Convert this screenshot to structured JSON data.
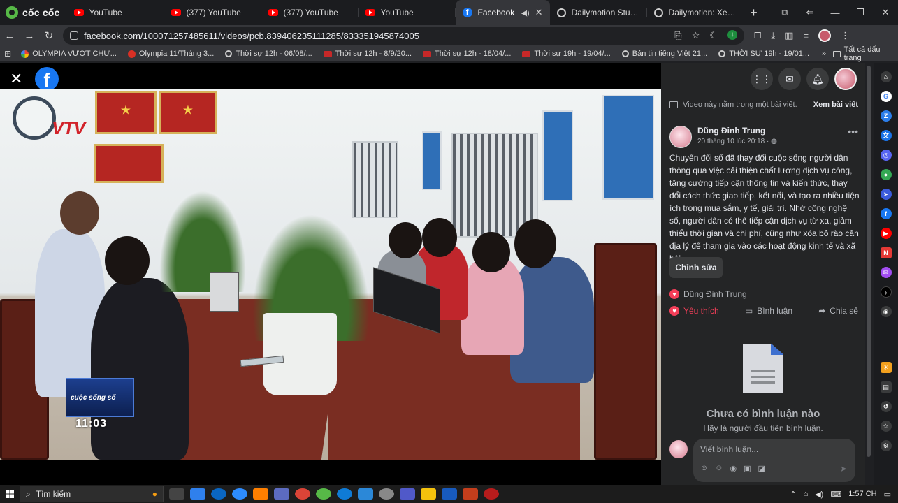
{
  "browser": {
    "brand": "cốc cốc",
    "tabs": [
      {
        "title": "YouTube",
        "icon": "youtube-icon",
        "active": false
      },
      {
        "title": "(377) YouTube",
        "icon": "youtube-icon",
        "active": false
      },
      {
        "title": "(377) YouTube",
        "icon": "youtube-icon",
        "active": false
      },
      {
        "title": "YouTube",
        "icon": "youtube-icon",
        "active": false
      },
      {
        "title": "Facebook",
        "icon": "facebook-icon",
        "active": true
      },
      {
        "title": "Dailymotion Studio",
        "icon": "dailymotion-icon",
        "active": false
      },
      {
        "title": "Dailymotion: Xem và c",
        "icon": "dailymotion-icon",
        "active": false
      }
    ],
    "url": "facebook.com/100071257485611/videos/pcb.839406235111285/833351945874005",
    "bookmarks": [
      {
        "label": "OLYMPIA VƯỢT CHƯ...",
        "icon": "google-icon"
      },
      {
        "label": "Olympia 11/Tháng 3...",
        "icon": "olympia-icon"
      },
      {
        "label": "Thời sự 12h - 06/08/...",
        "icon": "dailymotion-icon"
      },
      {
        "label": "Thời sự 12h - 8/9/20...",
        "icon": "vtv-icon"
      },
      {
        "label": "Thời sự 12h - 18/04/...",
        "icon": "vtv-icon"
      },
      {
        "label": "Thời sự 19h - 19/04/...",
        "icon": "vtv-icon"
      },
      {
        "label": "Bản tin tiếng Việt 21...",
        "icon": "dailymotion-icon"
      },
      {
        "label": "THỜI SỰ 19h - 19/01...",
        "icon": "dailymotion-icon"
      }
    ],
    "bookmarks_folder": "Tất cả dấu trang"
  },
  "video": {
    "channel_logo": "VTV",
    "ticker_label": "cuộc sống số",
    "ticker_time": "11:03"
  },
  "post": {
    "notice": "Video này nằm trong một bài viết.",
    "notice_link": "Xem bài viết",
    "author": "Dũng Đinh Trung",
    "time": "20 tháng 10 lúc 20:18 ·",
    "body": "Chuyển đổi số đã thay đổi cuộc sống người dân thông qua việc cải thiện chất lượng dịch vụ công, tăng cường tiếp cận thông tin và kiến thức, thay đổi cách thức giao tiếp, kết nối, và tạo ra nhiều tiện ích trong mua sắm, y tế, giải trí. Nhờ công nghệ số, người dân có thể tiếp cận dịch vụ từ xa, giảm thiểu thời gian và chi phí, cũng như xóa bỏ rào cản địa lý để tham gia vào các hoạt động kinh tế và xã hội",
    "edit_label": "Chỉnh sửa",
    "reactor": "Dũng Đinh Trung",
    "actions": {
      "like": "Yêu thích",
      "comment": "Bình luận",
      "share": "Chia sẻ"
    },
    "empty_title": "Chưa có bình luận nào",
    "empty_sub": "Hãy là người đầu tiên bình luận.",
    "comment_placeholder": "Viết bình luận..."
  },
  "taskbar": {
    "search_label": "Tìm kiếm",
    "time": "1:57 CH"
  },
  "colors": {
    "facebook_blue": "#1877f2",
    "like_red": "#f33e58",
    "panel_bg": "#242526"
  }
}
